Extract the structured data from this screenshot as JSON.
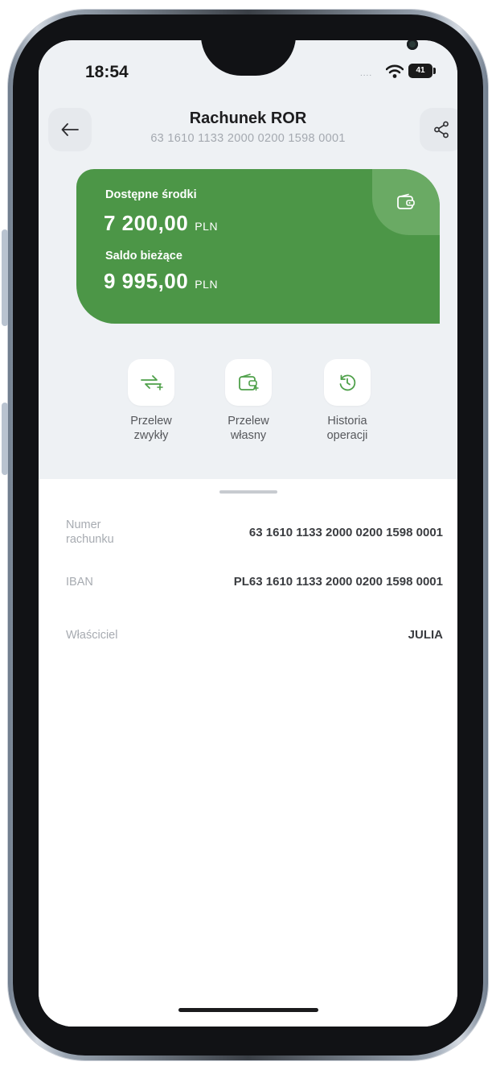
{
  "status_bar": {
    "time": "18:54",
    "signal_dots": "....",
    "battery_level": "41"
  },
  "header": {
    "title": "Rachunek ROR",
    "account_number": "63 1610 1133 2000 0200 1598 0001"
  },
  "balance_card": {
    "available_label": "Dostępne środki",
    "available_amount": "7 200,00",
    "available_currency": "PLN",
    "current_label": "Saldo bieżące",
    "current_amount": "9 995,00",
    "current_currency": "PLN",
    "card_color": "#4c9647"
  },
  "actions": [
    {
      "label_line1": "Przelew",
      "label_line2": "zwykły",
      "icon": "transfer-arrows-icon"
    },
    {
      "label_line1": "Przelew",
      "label_line2": "własny",
      "icon": "wallet-icon"
    },
    {
      "label_line1": "Historia",
      "label_line2": "operacji",
      "icon": "history-clock-icon"
    }
  ],
  "details": [
    {
      "label_line1": "Numer",
      "label_line2": "rachunku",
      "value": "63 1610 1133 2000 0200 1598 0001"
    },
    {
      "label_line1": "IBAN",
      "label_line2": "",
      "value": "PL63 1610 1133 2000 0200 1598 0001"
    },
    {
      "label_line1": "Właściciel",
      "label_line2": "",
      "value": "JULIA"
    }
  ],
  "theme": {
    "accent_green": "#4c9647",
    "icon_green": "#4fa04a"
  }
}
